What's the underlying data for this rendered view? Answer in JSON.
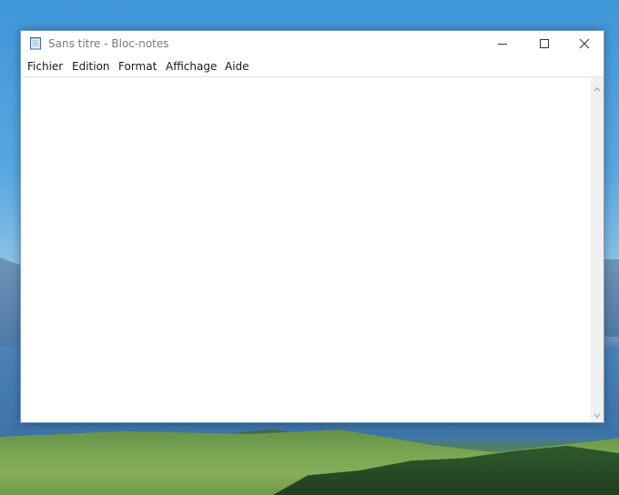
{
  "window": {
    "title": "Sans titre - Bloc-notes",
    "app_icon": "notepad-icon"
  },
  "controls": {
    "minimize_icon": "minimize-icon",
    "maximize_icon": "maximize-icon",
    "close_icon": "close-icon"
  },
  "menu": {
    "items": [
      {
        "label": "Fichier"
      },
      {
        "label": "Edition"
      },
      {
        "label": "Format"
      },
      {
        "label": "Affichage"
      },
      {
        "label": "Aide"
      }
    ]
  },
  "editor": {
    "content": ""
  },
  "scrollbar": {
    "up_icon": "chevron-up-icon",
    "down_icon": "chevron-down-icon"
  },
  "colors": {
    "window_border": "#7a9ec4",
    "title_text": "#7a7a7a",
    "scrollbar_track": "#f0f0f0"
  }
}
